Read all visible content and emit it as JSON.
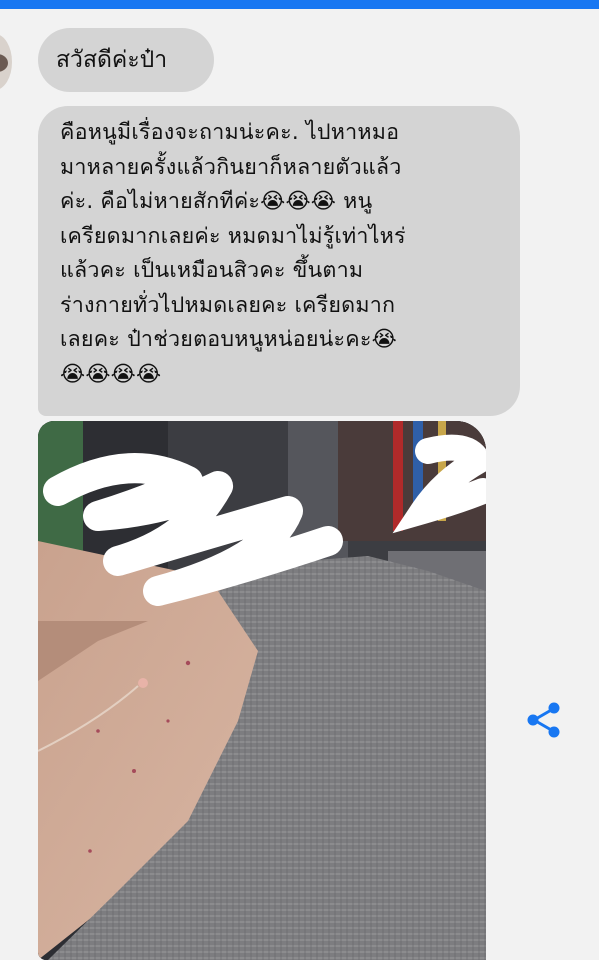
{
  "chat": {
    "greeting": "สวัสดีค่ะป๋า",
    "message_lines": [
      "คือหนูมีเรื่องจะถามน่ะคะ. ไปหาหมอ",
      "มาหลายครั้งแล้วกินยาก็หลายตัวแล้ว",
      "ค่ะ. คือไม่หายสักทีค่ะ😭😭😭 หนู",
      "เครียดมากเลยค่ะ หมดมาไม่รู้เท่าไหร่",
      "แล้วคะ เป็นเหมือนสิวคะ ขึ้นตาม",
      "ร่างกายทั่วไปหมดเลยคะ เครียดมาก",
      "เลยคะ ป๋าช่วยตอบหนูหน่อยน่ะคะ😭",
      "😭😭😭😭"
    ]
  },
  "icons": {
    "share": "share-icon",
    "avatar": "avatar"
  },
  "colors": {
    "top_bar": "#1877f2",
    "bubble": "#d4d4d4",
    "share_icon": "#1877f2"
  }
}
